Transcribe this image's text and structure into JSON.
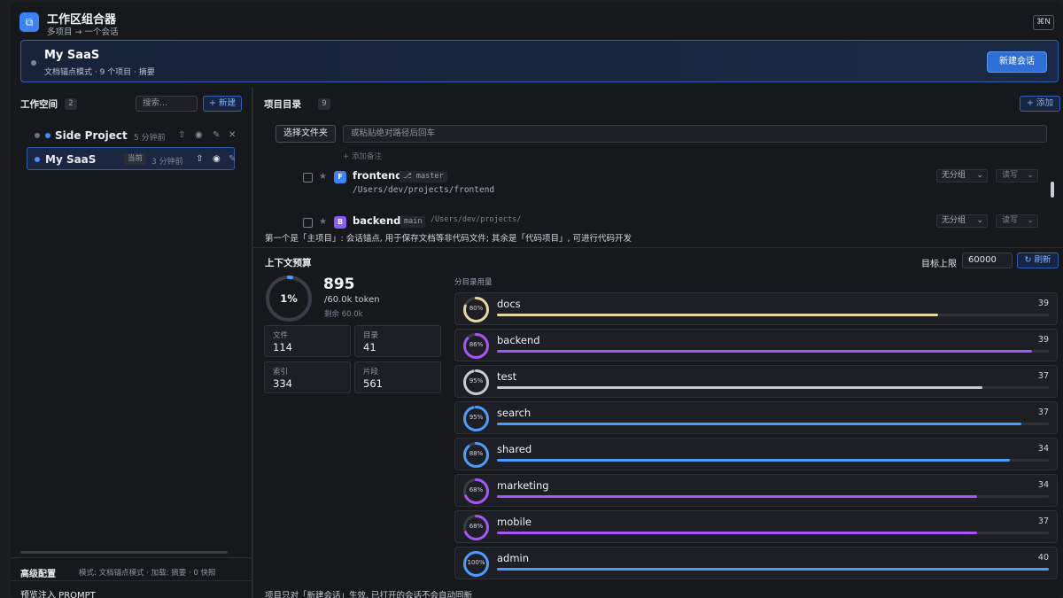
{
  "header": {
    "title": "工作区组合器",
    "subtitle": "多项目 → 一个会话",
    "shortcut": "⌘N",
    "logo_icon": "layers-icon"
  },
  "banner": {
    "name": "My SaaS",
    "meta": "文档锚点模式 · 9 个项目 · 摘要",
    "new_session": "新建会话"
  },
  "workspaces": {
    "title": "工作空间",
    "count": "2",
    "search_placeholder": "搜索...",
    "new_label": "+ 新建",
    "items": [
      {
        "name": "Side Project",
        "time": "5 分钟前",
        "active": false
      },
      {
        "name": "My SaaS",
        "tag": "当前",
        "time": "3 分钟前",
        "active": true
      }
    ],
    "advanced_title": "高级配置",
    "advanced_meta": "模式: 文档锚点模式 · 加载: 摘要 · 0 快照",
    "preview_title": "预览注入 PROMPT"
  },
  "projects": {
    "title": "项目目录",
    "count": "9",
    "add_label": "+ 添加",
    "select_folder": "选择文件夹",
    "path_placeholder": "或粘贴绝对路径后回车",
    "note": "+ 添加备注",
    "items": [
      {
        "name": "frontend",
        "icon_letter": "F",
        "branch": "⎇ master",
        "path": "/Users/dev/projects/frontend",
        "group": "无分组",
        "mode": "读写",
        "color": "#3b82f6"
      },
      {
        "name": "backend",
        "icon_letter": "B",
        "branch": "main",
        "path": "/Users/dev/projects/",
        "group": "无分组",
        "mode": "读写",
        "color": "#8b5cf6"
      }
    ],
    "hint": "第一个是「主项目」: 会话锚点, 用于保存文档等非代码文件; 其余是「代码项目」, 可进行代码开发"
  },
  "context": {
    "title": "上下文预算",
    "target_label": "目标上限",
    "target_value": "60000",
    "refresh": "刷新",
    "percent": "1%",
    "percent_value": 1,
    "tokens": "895",
    "tokens_max": "/60.0k token",
    "remaining": "剩余 60.0k",
    "stats": [
      {
        "label": "文件",
        "value": "114"
      },
      {
        "label": "目录",
        "value": "41"
      },
      {
        "label": "索引",
        "value": "334"
      },
      {
        "label": "片段",
        "value": "561"
      }
    ],
    "dir_usage_title": "分目录用量",
    "dirs": [
      {
        "name": "docs",
        "count": "39",
        "pct": "80%",
        "ring": 80,
        "bar": 80,
        "color": "#e6d9a0"
      },
      {
        "name": "backend",
        "count": "39",
        "pct": "86%",
        "ring": 86,
        "bar": 97,
        "color": "#a855f7"
      },
      {
        "name": "test",
        "count": "37",
        "pct": "95%",
        "ring": 95,
        "bar": 88,
        "color": "#c7cad1"
      },
      {
        "name": "search",
        "count": "37",
        "pct": "95%",
        "ring": 95,
        "bar": 95,
        "color": "#4b9cff"
      },
      {
        "name": "shared",
        "count": "34",
        "pct": "88%",
        "ring": 88,
        "bar": 93,
        "color": "#4b9cff"
      },
      {
        "name": "marketing",
        "count": "34",
        "pct": "68%",
        "ring": 68,
        "bar": 87,
        "color": "#a855f7"
      },
      {
        "name": "mobile",
        "count": "37",
        "pct": "68%",
        "ring": 68,
        "bar": 87,
        "color": "#a855f7"
      },
      {
        "name": "admin",
        "count": "40",
        "pct": "100%",
        "ring": 100,
        "bar": 100,
        "color": "#4b9cff"
      }
    ]
  },
  "footer": "项目只对「新建会话」生效, 已打开的会话不会自动同新"
}
